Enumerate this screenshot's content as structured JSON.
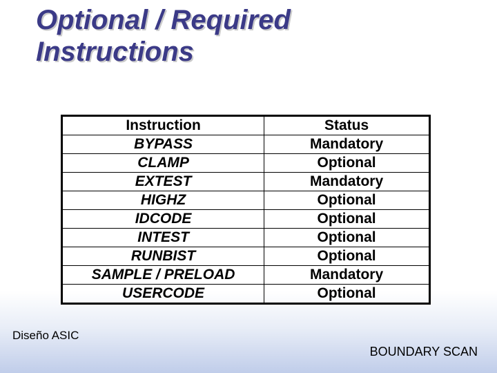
{
  "title_line1": "Optional / Required",
  "title_line2": "Instructions",
  "table": {
    "header": {
      "instruction": "Instruction",
      "status": "Status"
    },
    "rows": [
      {
        "instruction": "BYPASS",
        "status": "Mandatory"
      },
      {
        "instruction": "CLAMP",
        "status": "Optional"
      },
      {
        "instruction": "EXTEST",
        "status": "Mandatory"
      },
      {
        "instruction": "HIGHZ",
        "status": "Optional"
      },
      {
        "instruction": "IDCODE",
        "status": "Optional"
      },
      {
        "instruction": "INTEST",
        "status": "Optional"
      },
      {
        "instruction": "RUNBIST",
        "status": "Optional"
      },
      {
        "instruction": "SAMPLE / PRELOAD",
        "status": "Mandatory"
      },
      {
        "instruction": "USERCODE",
        "status": "Optional"
      }
    ]
  },
  "footer": {
    "left": "Diseño ASIC",
    "right": "BOUNDARY SCAN"
  }
}
